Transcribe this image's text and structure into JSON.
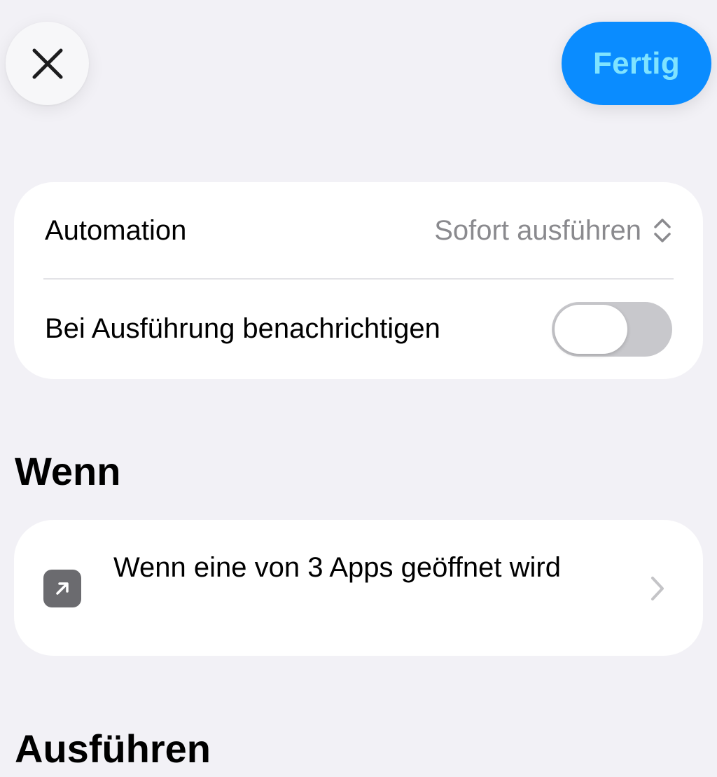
{
  "toolbar": {
    "close_icon": "close-icon",
    "done_label": "Fertig",
    "done_color": "#0a8cff"
  },
  "settings": {
    "automation_label": "Automation",
    "automation_value": "Sofort ausführen",
    "notify_label": "Bei Ausführung benachrichtigen",
    "notify_enabled": false
  },
  "when_section": {
    "title": "Wenn",
    "trigger_label": "Wenn eine von 3 Apps geöffnet wird",
    "trigger_icon": "app-open-arrow-icon"
  },
  "run_section": {
    "title": "Ausführen"
  }
}
